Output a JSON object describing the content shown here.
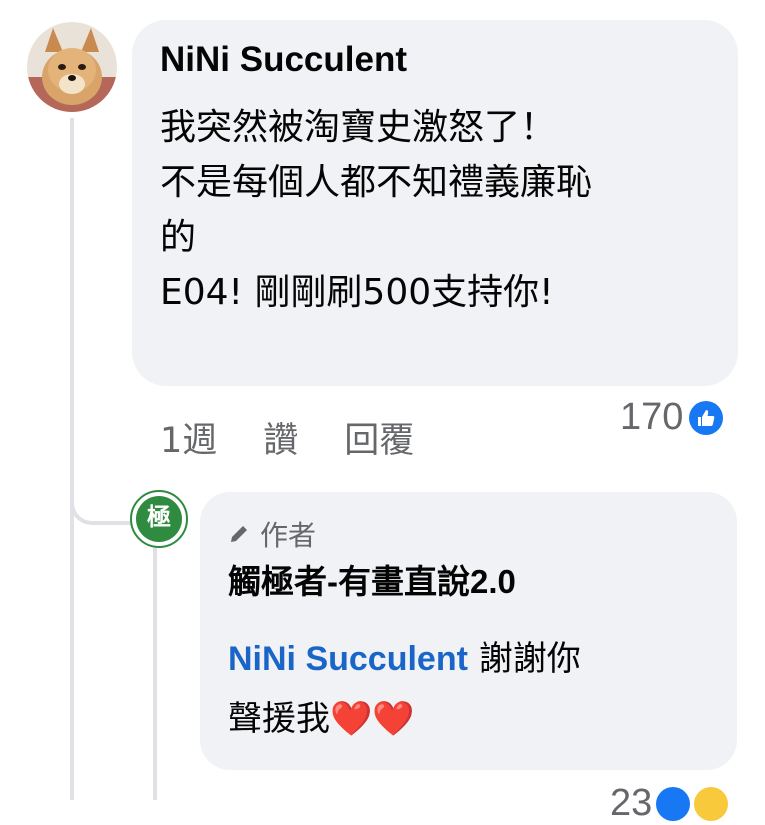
{
  "comment": {
    "author": "NiNi Succulent",
    "lines": [
      "我突然被淘寶史激怒了！",
      "不是每個人都不知禮義廉恥",
      "的",
      "E04!  剛剛刷500支持你!"
    ],
    "time": "1週",
    "like_label": "讚",
    "reply_label": "回覆",
    "reaction_count": "170"
  },
  "reply": {
    "author_badge": "作者",
    "author": "觸極者-有畫直說2.0",
    "mention": "NiNi Succulent",
    "text_line1": " 謝謝你",
    "text_line2": "聲援我",
    "hearts": "❤️❤️",
    "avatar_char": "極",
    "reaction_count": "23"
  },
  "icons": [
    "dog-avatar",
    "brand-avatar",
    "pencil-icon",
    "thumbs-up-icon",
    "heart-emoji",
    "wow-emoji"
  ],
  "colors": {
    "bubble": "#f0f2f5",
    "link": "#1a66c8",
    "like": "#1877f2",
    "meta": "#65676b",
    "brand_green": "#2e8b3f"
  }
}
